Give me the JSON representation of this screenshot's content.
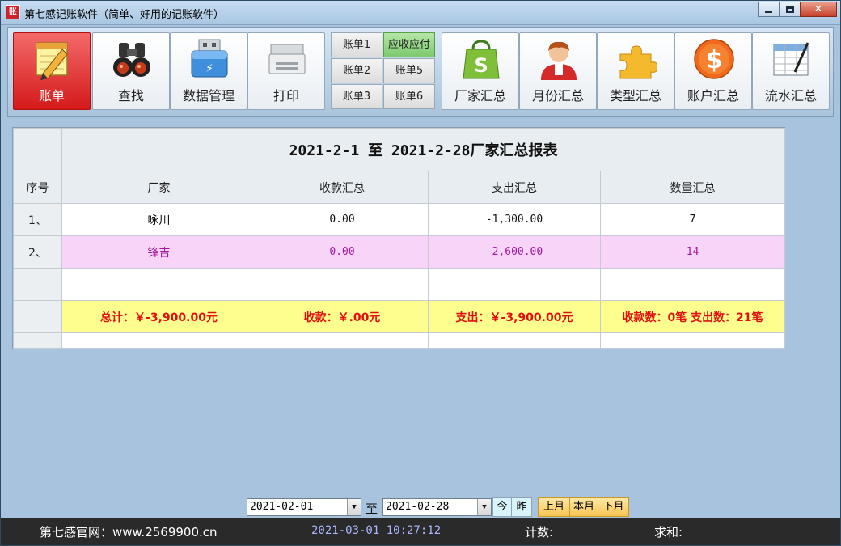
{
  "window": {
    "app_icon_text": "账",
    "title": "第七感记账软件（简单、好用的记账软件）"
  },
  "toolbar": {
    "main_buttons": [
      {
        "label": "账单",
        "icon": "pencil-notepad-icon",
        "active": true
      },
      {
        "label": "查找",
        "icon": "binoculars-icon",
        "active": false
      },
      {
        "label": "数据管理",
        "icon": "usb-drive-icon",
        "active": false
      },
      {
        "label": "打印",
        "icon": "printer-icon",
        "active": false
      }
    ],
    "sub_buttons": [
      {
        "label": "账单1",
        "active": false
      },
      {
        "label": "应收应付",
        "active": true
      },
      {
        "label": "账单2",
        "active": false
      },
      {
        "label": "账单5",
        "active": false
      },
      {
        "label": "账单3",
        "active": false
      },
      {
        "label": "账单6",
        "active": false
      }
    ],
    "summary_buttons": [
      {
        "label": "厂家汇总",
        "icon": "shopping-bag-icon"
      },
      {
        "label": "月份汇总",
        "icon": "person-icon"
      },
      {
        "label": "类型汇总",
        "icon": "puzzle-icon"
      },
      {
        "label": "账户汇总",
        "icon": "dollar-coin-icon"
      },
      {
        "label": "流水汇总",
        "icon": "spreadsheet-pen-icon"
      }
    ]
  },
  "report": {
    "title": "2021-2-1 至 2021-2-28厂家汇总报表",
    "headers": [
      "序号",
      "厂家",
      "收款汇总",
      "支出汇总",
      "数量汇总"
    ],
    "rows": [
      {
        "idx": "1、",
        "vendor": "咏川",
        "income": "0.00",
        "expense": "-1,300.00",
        "qty": "7"
      },
      {
        "idx": "2、",
        "vendor": "锋吉",
        "income": "0.00",
        "expense": "-2,600.00",
        "qty": "14"
      }
    ],
    "totals": {
      "total": "总计：￥-3,900.00元",
      "income": "收款：￥.00元",
      "expense": "支出：￥-3,900.00元",
      "counts": "收款数：0笔  支出数：21笔"
    }
  },
  "filter": {
    "from_date": "2021-02-01",
    "to_label": "至",
    "to_date": "2021-02-28",
    "today": "今",
    "yesterday": "昨",
    "last_month": "上月",
    "this_month": "本月",
    "next_month": "下月"
  },
  "status": {
    "site": "第七感官网：www.2569900.cn",
    "datetime": "2021-03-01 10:27:12",
    "count_label": "计数:",
    "sum_label": "求和:"
  },
  "colors": {
    "active_button": "#d41a1a",
    "active_sub": "#7cc96b",
    "alt_row": "#f7d4f8",
    "alt_row_text": "#a3189f",
    "total_row": "#fefe8e",
    "total_text": "#e01010"
  }
}
